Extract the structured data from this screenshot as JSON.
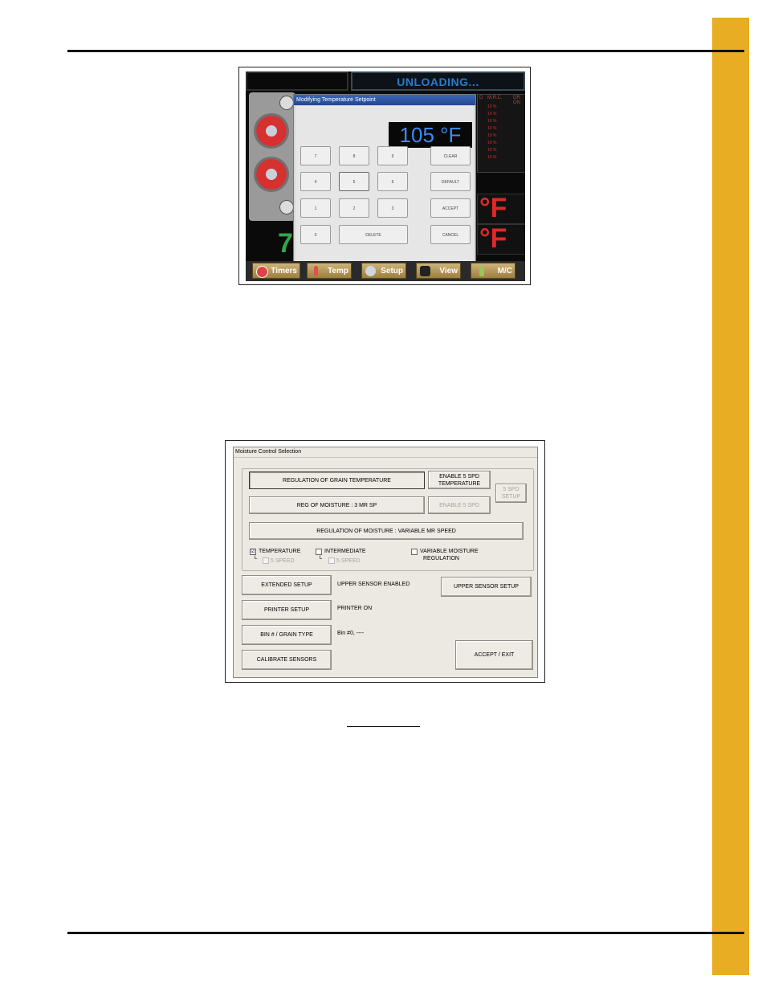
{
  "figure1": {
    "status": "UNLOADING...",
    "dialog_title": "Modifying Temperature Setpoint",
    "setpoint": "105 °F",
    "keys": [
      "7",
      "8",
      "9",
      "4",
      "5",
      "6",
      "1",
      "2",
      "3",
      "0"
    ],
    "clear": "CLEAR",
    "default": "DEFAULT",
    "accept": "ACCEPT",
    "cancel": "CANCEL",
    "delete": "DELETE",
    "mrc_headers": [
      "D",
      "M.R.C.",
      "DR ON"
    ],
    "mrc_values": [
      "10 %",
      "10 %",
      "10 %",
      "10 %",
      "10 %",
      "10 %",
      "10 %",
      "10 %"
    ],
    "big_left": "7",
    "temp_unit_1": "°F",
    "temp_unit_2": "°F",
    "nav": [
      "Timers",
      "Temp",
      "Setup",
      "View",
      "M/C"
    ],
    "colors": {
      "status": "#2a7bd0",
      "readout": "#3d8cf0",
      "temp_red": "#e02828",
      "green": "#2fa84a"
    }
  },
  "figure2": {
    "window_title": "Moisture Control Selection",
    "btn_regulation_temp": "REGULATION OF GRAIN TEMPERATURE",
    "btn_enable5_temp": "ENABLE 5 SPD TEMPERATURE",
    "btn_5spd_setup": "5 SPD SETUP",
    "btn_reg_moisture": "REG OF MOISTURE : 3 MR SP",
    "btn_enable5": "ENABLE 5 SPD",
    "btn_variable": "REGULATION OF MOISTURE : VARIABLE MR SPEED",
    "opt_temperature": "TEMPERATURE",
    "opt_intermediate": "INTERMEDIATE",
    "opt_variable": "VARIABLE MOISTURE",
    "opt_variable_2": "REGULATION",
    "opt_5speed_a": "5 SPEED",
    "opt_5speed_b": "5 SPEED",
    "btn_extended": "EXTENDED SETUP",
    "txt_upper_enabled": "UPPER SENSOR ENABLED",
    "btn_upper_setup": "UPPER SENSOR SETUP",
    "btn_printer": "PRINTER SETUP",
    "txt_printer_on": "PRINTER ON",
    "btn_bin": "BIN # / GRAIN TYPE",
    "txt_bin": "Bin #0, ----",
    "btn_calibrate": "CALIBRATE SENSORS",
    "btn_accept_exit": "ACCEPT / EXIT",
    "checked_temperature": "☑"
  },
  "colors": {
    "tab": "#e8ad22"
  }
}
